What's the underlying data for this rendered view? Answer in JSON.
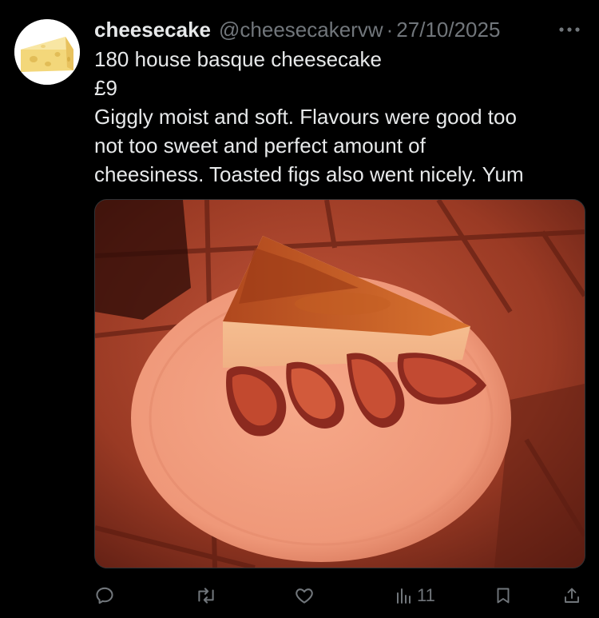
{
  "tweet": {
    "author": {
      "display_name": "cheesecake",
      "handle": "@cheesecakervw",
      "avatar_icon": "cheese-wedge-icon"
    },
    "separator": "·",
    "date": "27/10/2025",
    "more_icon": "more-horizontal-icon",
    "text_lines": [
      "180 house basque cheesecake",
      "£9",
      "Giggly moist and soft. Flavours were good too",
      "not too sweet and perfect amount of",
      "cheesiness. Toasted figs also went nicely. Yum"
    ],
    "media": {
      "kind": "photo",
      "subject": "cheesecake-slice-with-figs"
    },
    "actions": {
      "reply_icon": "reply-icon",
      "retweet_icon": "retweet-icon",
      "like_icon": "heart-icon",
      "views_icon": "views-chart-icon",
      "views_count": "11",
      "bookmark_icon": "bookmark-icon",
      "share_icon": "share-icon"
    }
  },
  "colors": {
    "background": "#000000",
    "primary_text": "#e7e9ea",
    "secondary_text": "#71767b"
  }
}
